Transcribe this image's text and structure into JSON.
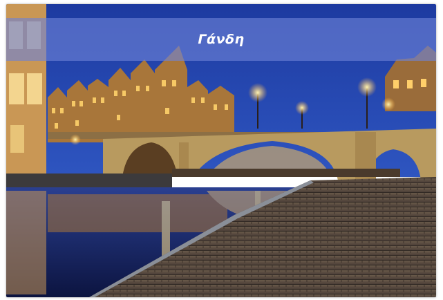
{
  "card": {
    "title": "Γάνδη",
    "image_subject": "night-city-canal-bridge-photo"
  },
  "colors": {
    "sky_top": "#1e3a9e",
    "sky_bottom": "#2f4fb4",
    "title_band": "#6e82d7",
    "title_text": "#ffffff",
    "stone": "#b99a5e",
    "lights": "#ffd56a",
    "cobblestone": "#5c4f46"
  }
}
